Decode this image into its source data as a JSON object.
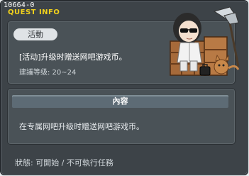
{
  "window": {
    "quest_id": "10664-0",
    "title": "QUEST INFO"
  },
  "summary": {
    "tag": "活動",
    "quest_name": "[活动]升级时赠送网吧游戏币。",
    "level_label": "建議等级: 20~24"
  },
  "content": {
    "header": "內容",
    "text": "在专属网吧升级时赠送网吧游戏币。"
  },
  "status": "狀態: 可開始 / 不可執行任務",
  "icons": [
    "character-portrait",
    "scythe-icon",
    "crate-icon",
    "bag-icon",
    "cat-icon"
  ]
}
